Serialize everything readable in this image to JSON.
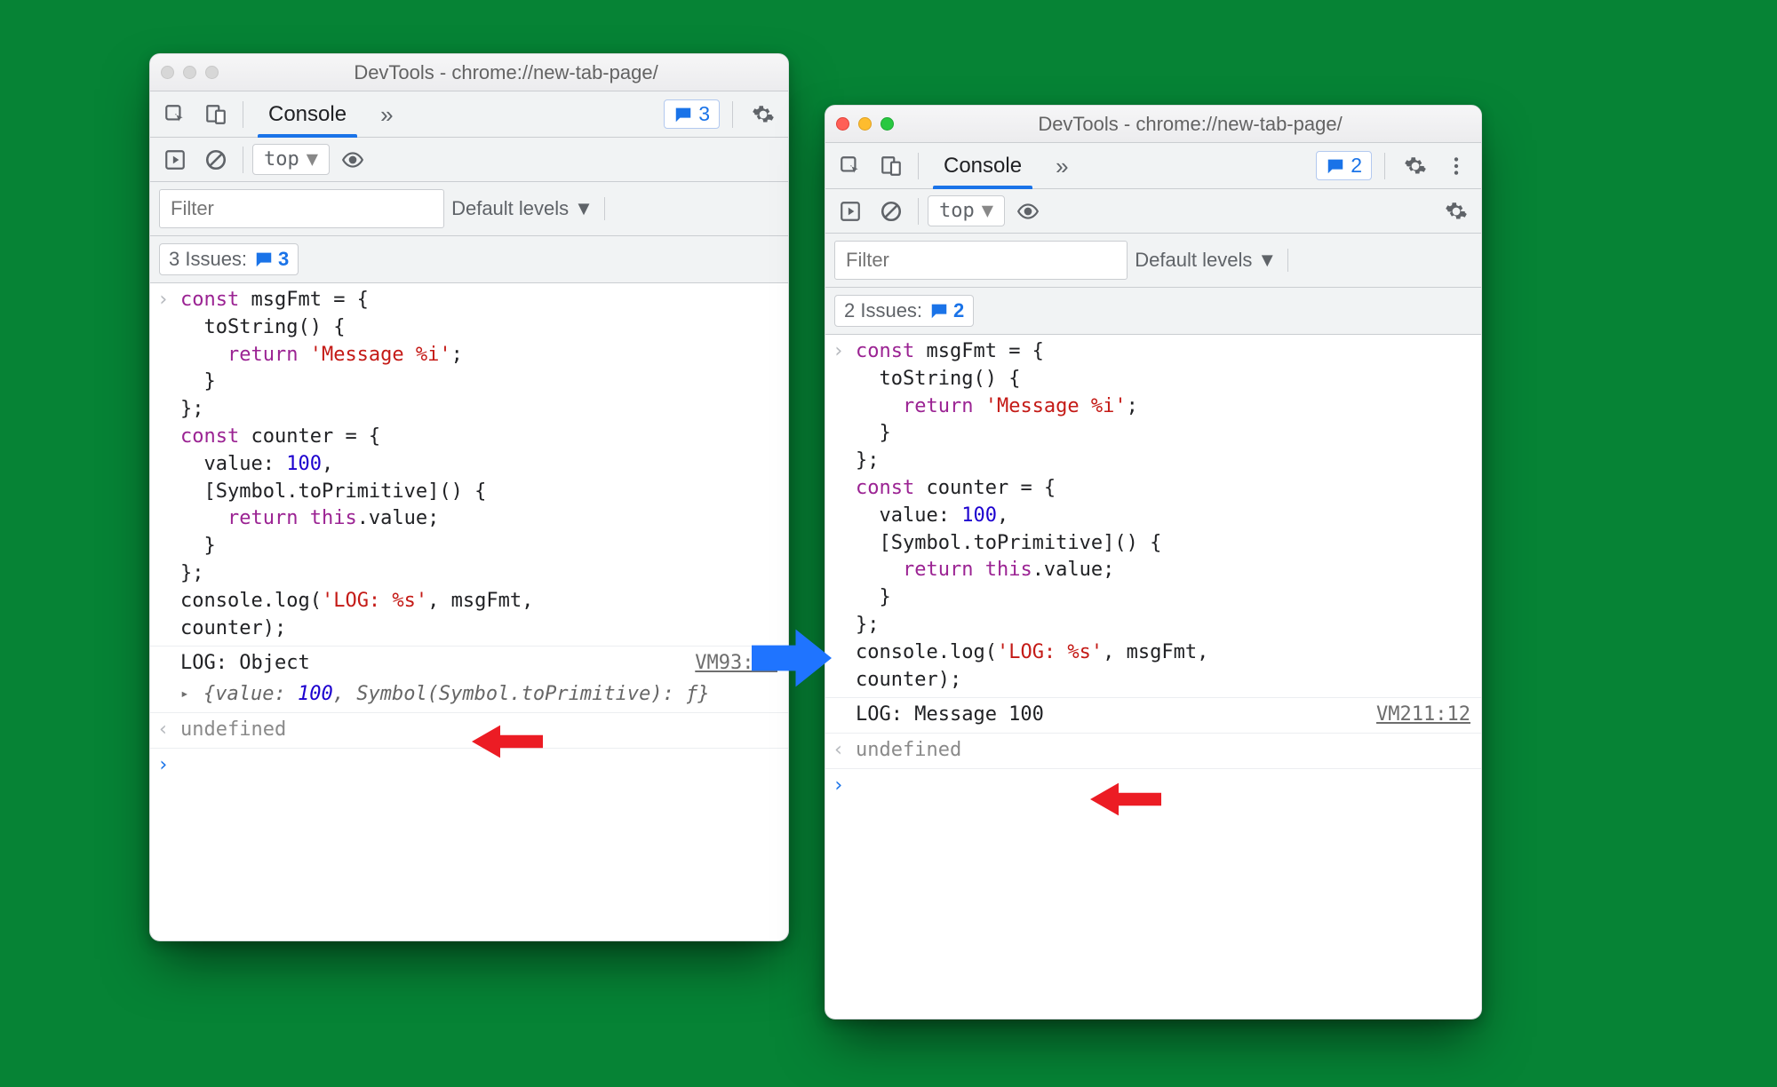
{
  "leftWindow": {
    "title": "DevTools - chrome://new-tab-page/",
    "trafficActive": false,
    "tabs": {
      "active": "Console"
    },
    "issuesCountPill": "3",
    "context": "top",
    "filterPlaceholder": "Filter",
    "levelsLabel": "Default levels",
    "issuesChip": {
      "label": "3 Issues:",
      "count": "3"
    },
    "output": {
      "logLine": "LOG: Object",
      "srcRef": "VM93:12",
      "objectPreview": "{value: 100, Symbol(Symbol.toPrimitive): ƒ}",
      "objectValueNum": "100",
      "returnValue": "undefined"
    }
  },
  "rightWindow": {
    "title": "DevTools - chrome://new-tab-page/",
    "trafficActive": true,
    "tabs": {
      "active": "Console"
    },
    "issuesCountPill": "2",
    "context": "top",
    "filterPlaceholder": "Filter",
    "levelsLabel": "Default levels",
    "issuesChip": {
      "label": "2 Issues:",
      "count": "2"
    },
    "output": {
      "logLine": "LOG: Message 100",
      "srcRef": "VM211:12",
      "returnValue": "undefined"
    }
  },
  "sharedCode": {
    "line1a": "const",
    "line1b": " msgFmt = {",
    "line2": "  toString() {",
    "line3a": "    return ",
    "line3b": "'Message %i'",
    "line3c": ";",
    "line4": "  }",
    "line5": "};",
    "line6a": "const",
    "line6b": " counter = {",
    "line7a": "  value: ",
    "line7b": "100",
    "line7c": ",",
    "line8": "  [Symbol.toPrimitive]() {",
    "line9a": "    return ",
    "line9b": "this",
    "line9c": ".value;",
    "line10": "  }",
    "line11": "};",
    "line12a": "console.log(",
    "line12b": "'LOG: %s'",
    "line12c": ", msgFmt,",
    "line13": "counter);"
  }
}
